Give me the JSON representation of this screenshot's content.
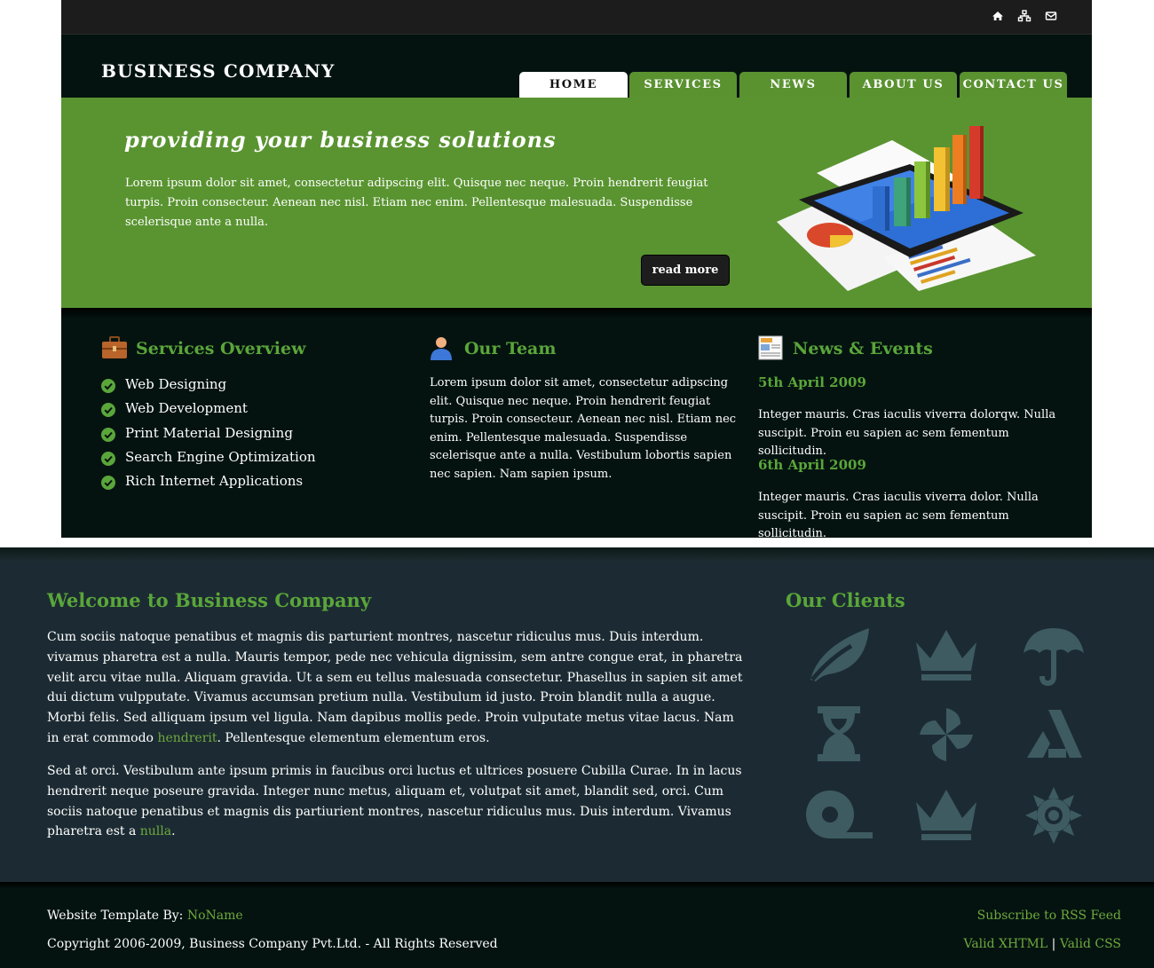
{
  "header": {
    "logo": "BUSINESS COMPANY",
    "utility_icons": [
      "home-icon",
      "sitemap-icon",
      "envelope-icon"
    ]
  },
  "nav": {
    "tabs": [
      {
        "label": "HOME",
        "active": true
      },
      {
        "label": "SERVICES",
        "active": false
      },
      {
        "label": "NEWS",
        "active": false
      },
      {
        "label": "ABOUT US",
        "active": false
      },
      {
        "label": "CONTACT US",
        "active": false
      }
    ]
  },
  "hero": {
    "title": "providing your business solutions",
    "text": "Lorem ipsum dolor sit amet, consectetur adipscing elit. Quisque nec neque. Proin hendrerit feugiat turpis. Proin consecteur. Aenean nec nisl. Etiam nec enim. Pellentesque malesuada. Suspendisse scelerisque ante a nulla.",
    "button": "read more",
    "image_icon": "bar-chart-tablet-icon"
  },
  "services": {
    "title": "Services Overview",
    "icon": "briefcase-icon",
    "items": [
      "Web Designing",
      "Web Development",
      "Print Material Designing",
      "Search Engine Optimization",
      "Rich Internet Applications"
    ]
  },
  "team": {
    "title": "Our Team",
    "icon": "user-icon",
    "text": "Lorem ipsum dolor sit amet, consectetur adipscing elit. Quisque nec neque. Proin hendrerit feugiat turpis. Proin consecteur. Aenean nec nisl. Etiam nec enim. Pellentesque malesuada. Suspendisse scelerisque ante a nulla. Vestibulum lobortis sapien nec sapien. Nam sapien ipsum."
  },
  "news": {
    "title": "News & Events",
    "icon": "newspaper-icon",
    "items": [
      {
        "date": "5th April 2009",
        "text": "Integer mauris. Cras iaculis viverra dolorqw. Nulla suscipit. Proin eu sapien ac sem fementum sollicitudin."
      },
      {
        "date": "6th April 2009",
        "text": "Integer mauris. Cras iaculis viverra dolor. Nulla suscipit. Proin eu sapien ac sem fementum sollicitudin."
      }
    ]
  },
  "welcome": {
    "title": "Welcome to Business Company",
    "p1_a": "Cum sociis natoque penatibus et magnis dis parturient montres, nascetur ridiculus mus. Duis interdum. vivamus pharetra est a nulla. Mauris tempor, pede nec vehicula dignissim, sem antre congue erat, in pharetra velit arcu vitae nulla. Aliquam gravida. Ut a sem eu tellus malesuada consectetur. Phasellus in sapien sit amet dui dictum vulpputate. Vivamus accumsan pretium nulla. Vestibulum id justo. Proin blandit nulla a augue. Morbi felis. Sed alliquam ipsum vel ligula. Nam dapibus mollis pede. Proin vulputate metus vitae lacus. Nam in erat commodo ",
    "p1_link": "hendrerit",
    "p1_b": ". Pellentesque elementum elementum eros.",
    "p2_a": "Sed at orci. Vestibulum ante ipsum primis in faucibus orci luctus et ultrices posuere Cubilla Curae. In in lacus hendrerit neque poseure gravida. Integer nunc metus, aliquam et, volutpat sit amet, blandit sed, orci. Cum sociis natoque penatibus et magnis dis partiurient montres, nascetur ridiculus mus. Duis interdum. Vivamus pharetra est a ",
    "p2_link": "nulla",
    "p2_b": "."
  },
  "clients": {
    "title": "Our Clients",
    "icon_color": "#3e5b62",
    "logos": [
      "leaf-icon",
      "crown-icon",
      "umbrella-icon",
      "hourglass-icon",
      "pinwheel-icon",
      "triangle-a-icon",
      "tape-icon",
      "crown-icon",
      "sun-gear-icon"
    ]
  },
  "footer": {
    "template_by_label": "Website Template By: ",
    "template_by_link": "NoName",
    "copyright": "Copyright 2006-2009, Business Company Pvt.Ltd. - All Rights Reserved",
    "rss_link": "Subscribe to RSS Feed",
    "xhtml_link": "Valid XHTML",
    "separator": "|",
    "css_link": "Valid CSS"
  },
  "colors": {
    "brand_green": "#5a9431",
    "heading_green": "#5aa63a",
    "link_green": "#6ea93d",
    "dark_bg": "#041310",
    "lower_bg": "#1c2b33"
  }
}
